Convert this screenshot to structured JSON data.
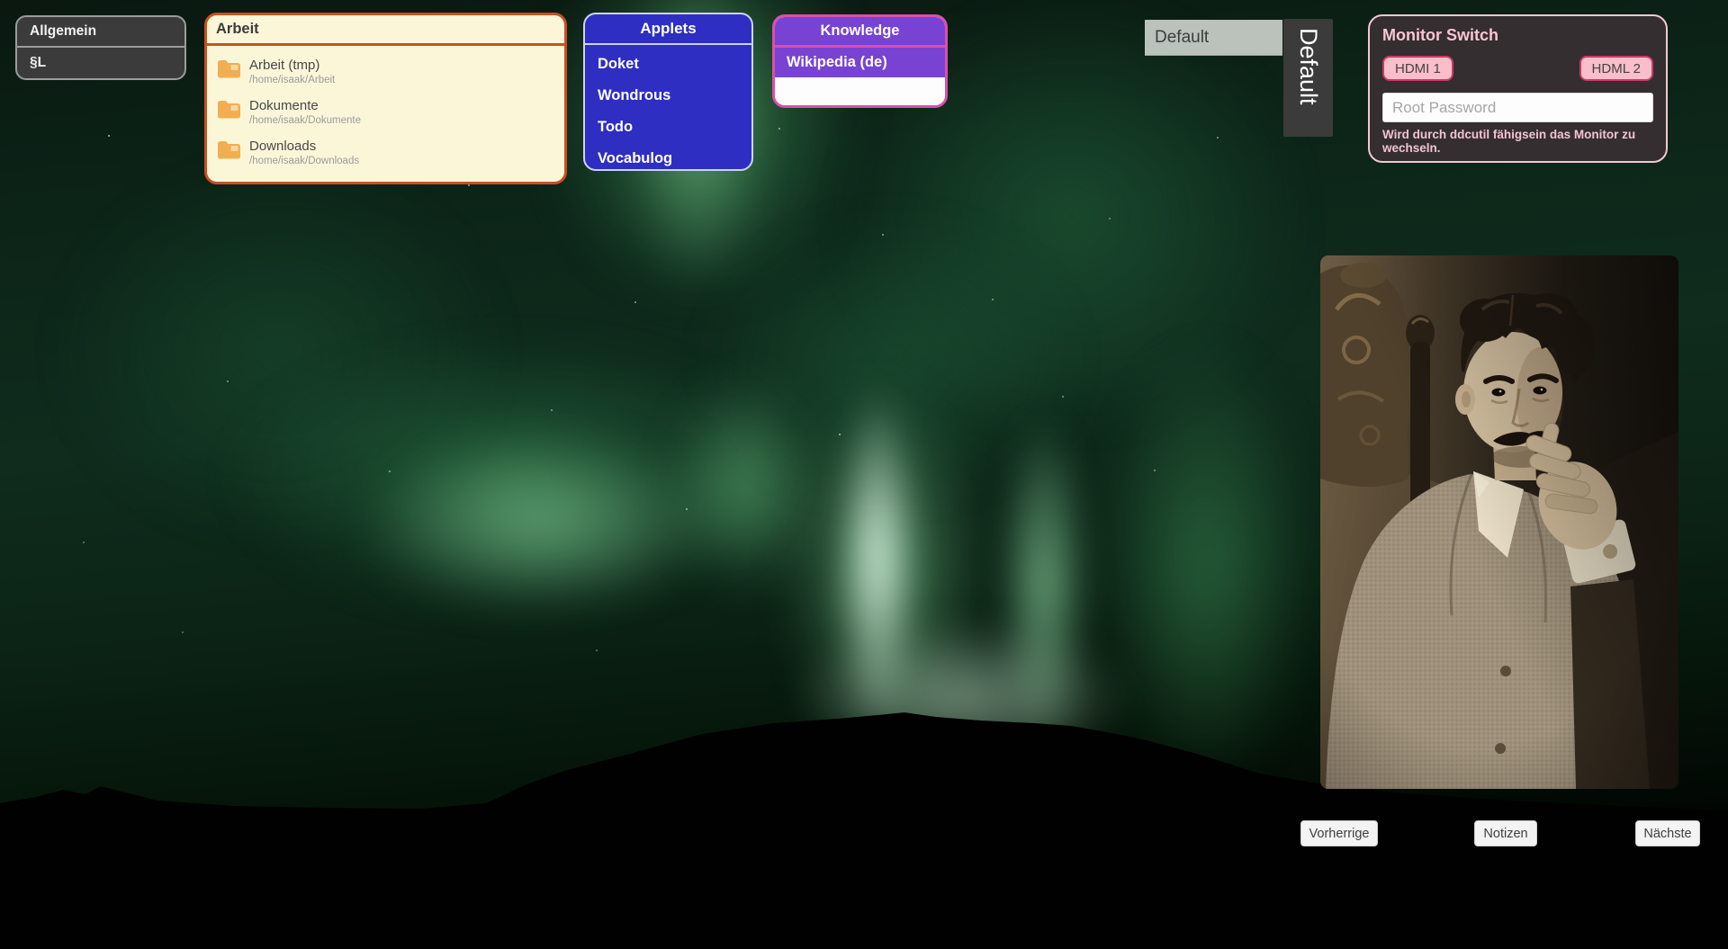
{
  "wallpaper": {
    "description": "Aurora borealis night sky over a dark mountain silhouette"
  },
  "panels": {
    "allgemein": {
      "rows": [
        {
          "label": "Allgemein"
        },
        {
          "label": "§L"
        }
      ]
    },
    "arbeit": {
      "title": "Arbeit",
      "items": [
        {
          "name": "Arbeit (tmp)",
          "path": "/home/isaak/Arbeit"
        },
        {
          "name": "Dokumente",
          "path": "/home/isaak/Dokumente"
        },
        {
          "name": "Downloads",
          "path": "/home/isaak/Downloads"
        }
      ]
    },
    "applets": {
      "title": "Applets",
      "items": [
        {
          "label": "Doket"
        },
        {
          "label": "Wondrous"
        },
        {
          "label": "Todo"
        },
        {
          "label": "Vocabulog"
        }
      ]
    },
    "knowledge": {
      "title": "Knowledge",
      "items": [
        {
          "label": "Wikipedia (de)"
        }
      ]
    },
    "monitor_switch": {
      "title": "Monitor Switch",
      "buttons": [
        {
          "label": "HDMI 1"
        },
        {
          "label": "HDML 2"
        }
      ],
      "password_placeholder": "Root Password",
      "note": "Wird durch ddcutil fähigsein das Monitor zu wechseln."
    }
  },
  "default_selector": {
    "value": "Default",
    "tab_label": "Default"
  },
  "footer_buttons": [
    {
      "label": "Vorherrige"
    },
    {
      "label": "Notizen"
    },
    {
      "label": "Nächste"
    }
  ],
  "photo": {
    "description": "Sepia portrait photograph of Nikola Tesla seated beside an ornate carved chair, hand resting at his chin"
  },
  "colors": {
    "arbeit_bg": "#fcf6d9",
    "arbeit_border": "#c8511f",
    "applets_bg": "#2e2ec2",
    "applets_border": "#ccd4f0",
    "knowledge_bg": "#7843d2",
    "knowledge_border": "#d94fae",
    "monitor_bg": "#342e31",
    "monitor_accent": "#f8c6d3",
    "monitor_button_bg": "#f9bec9",
    "monitor_button_border": "#c93b66",
    "dark_panel_bg": "#3b3b3b",
    "dark_panel_border": "#9c9c9c",
    "default_box_bg": "#cad0ca",
    "aurora_green": "#57c879"
  }
}
